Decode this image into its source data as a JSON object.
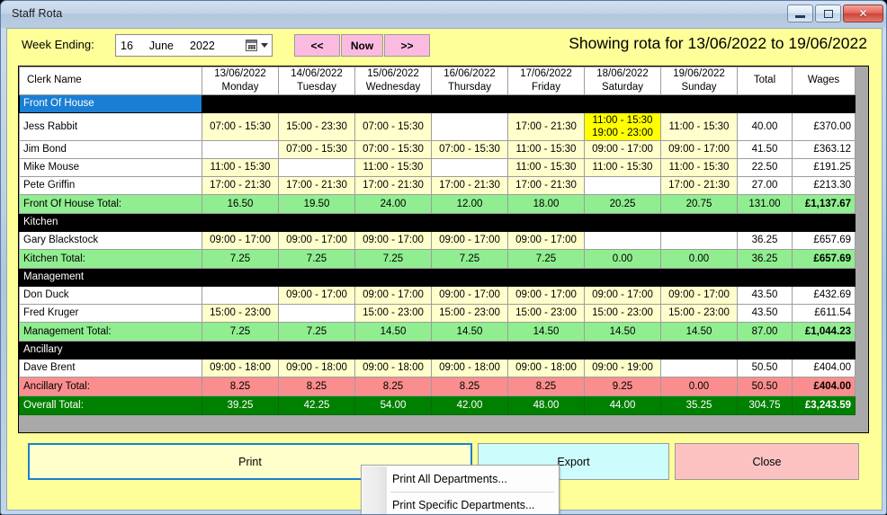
{
  "window": {
    "title": "Staff Rota",
    "minimize_label": "minimize",
    "maximize_label": "maximize",
    "close_label": "✕"
  },
  "toolbar": {
    "week_ending_label": "Week Ending:",
    "date": {
      "day": "16",
      "month": "June",
      "year": "2022"
    },
    "prev_label": "<<",
    "now_label": "Now",
    "next_label": ">>",
    "showing_text": "Showing rota for 13/06/2022 to 19/06/2022"
  },
  "grid": {
    "headers": {
      "name": "Clerk Name",
      "days": [
        {
          "date": "13/06/2022",
          "day": "Monday"
        },
        {
          "date": "14/06/2022",
          "day": "Tuesday"
        },
        {
          "date": "15/06/2022",
          "day": "Wednesday"
        },
        {
          "date": "16/06/2022",
          "day": "Thursday"
        },
        {
          "date": "17/06/2022",
          "day": "Friday"
        },
        {
          "date": "18/06/2022",
          "day": "Saturday"
        },
        {
          "date": "19/06/2022",
          "day": "Sunday"
        }
      ],
      "total": "Total",
      "wages": "Wages"
    },
    "rows": [
      {
        "kind": "dept-blue",
        "name": "Front Of House"
      },
      {
        "kind": "staff",
        "name": "Jess Rabbit",
        "shifts": [
          "07:00 - 15:30",
          "15:00 - 23:30",
          "07:00 - 15:30",
          "",
          "17:00 - 21:30",
          "11:00 - 15:30\n19:00 - 23:00",
          "11:00 - 15:30"
        ],
        "total": "40.00",
        "wages": "£370.00"
      },
      {
        "kind": "staff",
        "name": "Jim Bond",
        "shifts": [
          "",
          "07:00 - 15:30",
          "07:00 - 15:30",
          "07:00 - 15:30",
          "11:00 - 15:30",
          "09:00 - 17:00",
          "09:00 - 17:00"
        ],
        "total": "41.50",
        "wages": "£363.12"
      },
      {
        "kind": "staff",
        "name": "Mike Mouse",
        "shifts": [
          "11:00 - 15:30",
          "",
          "11:00 - 15:30",
          "",
          "11:00 - 15:30",
          "11:00 - 15:30",
          "11:00 - 15:30"
        ],
        "total": "22.50",
        "wages": "£191.25"
      },
      {
        "kind": "staff",
        "name": "Pete Griffin",
        "shifts": [
          "17:00 - 21:30",
          "17:00 - 21:30",
          "17:00 - 21:30",
          "17:00 - 21:30",
          "17:00 - 21:30",
          "",
          "17:00 - 21:30"
        ],
        "total": "27.00",
        "wages": "£213.30"
      },
      {
        "kind": "total-green",
        "name": "Front Of House Total:",
        "shifts": [
          "16.50",
          "19.50",
          "24.00",
          "12.00",
          "18.00",
          "20.25",
          "20.75"
        ],
        "total": "131.00",
        "wages": "£1,137.67"
      },
      {
        "kind": "dept-black",
        "name": "Kitchen"
      },
      {
        "kind": "staff",
        "name": "Gary Blackstock",
        "shifts": [
          "09:00 - 17:00",
          "09:00 - 17:00",
          "09:00 - 17:00",
          "09:00 - 17:00",
          "09:00 - 17:00",
          "",
          ""
        ],
        "total": "36.25",
        "wages": "£657.69"
      },
      {
        "kind": "total-green",
        "name": "Kitchen Total:",
        "shifts": [
          "7.25",
          "7.25",
          "7.25",
          "7.25",
          "7.25",
          "0.00",
          "0.00"
        ],
        "total": "36.25",
        "wages": "£657.69"
      },
      {
        "kind": "dept-black",
        "name": "Management"
      },
      {
        "kind": "staff",
        "name": "Don Duck",
        "shifts": [
          "",
          "09:00 - 17:00",
          "09:00 - 17:00",
          "09:00 - 17:00",
          "09:00 - 17:00",
          "09:00 - 17:00",
          "09:00 - 17:00"
        ],
        "total": "43.50",
        "wages": "£432.69"
      },
      {
        "kind": "staff",
        "name": "Fred Kruger",
        "shifts": [
          "15:00 - 23:00",
          "",
          "15:00 - 23:00",
          "15:00 - 23:00",
          "15:00 - 23:00",
          "15:00 - 23:00",
          "15:00 - 23:00"
        ],
        "total": "43.50",
        "wages": "£611.54"
      },
      {
        "kind": "total-green",
        "name": "Management Total:",
        "shifts": [
          "7.25",
          "7.25",
          "14.50",
          "14.50",
          "14.50",
          "14.50",
          "14.50"
        ],
        "total": "87.00",
        "wages": "£1,044.23"
      },
      {
        "kind": "dept-black",
        "name": "Ancillary"
      },
      {
        "kind": "staff",
        "name": "Dave Brent",
        "shifts": [
          "09:00 - 18:00",
          "09:00 - 18:00",
          "09:00 - 18:00",
          "09:00 - 18:00",
          "09:00 - 18:00",
          "09:00 - 19:00",
          ""
        ],
        "total": "50.50",
        "wages": "£404.00"
      },
      {
        "kind": "total-red",
        "name": "Ancillary Total:",
        "shifts": [
          "8.25",
          "8.25",
          "8.25",
          "8.25",
          "8.25",
          "9.25",
          "0.00"
        ],
        "total": "50.50",
        "wages": "£404.00"
      },
      {
        "kind": "total-dark",
        "name": "Overall Total:",
        "shifts": [
          "39.25",
          "42.25",
          "54.00",
          "42.00",
          "48.00",
          "44.00",
          "35.25"
        ],
        "total": "304.75",
        "wages": "£3,243.59"
      }
    ]
  },
  "buttons": {
    "print": "Print",
    "export": "Export",
    "close": "Close"
  },
  "context_menu": {
    "items": [
      "Print All Departments...",
      "Print Specific Departments..."
    ]
  },
  "colors": {
    "client_bg": "#ffff99",
    "shift_cell": "#ffffcc",
    "double_shift_cell": "#ffff00",
    "dept_header_accent": "#1a7fd4",
    "total_green": "#90ee90",
    "total_red": "#fa8e8e",
    "overall_green": "#008000",
    "nav_button": "#fbbbe1",
    "export_button": "#cdfcfc",
    "close_button": "#fcc2c2"
  }
}
